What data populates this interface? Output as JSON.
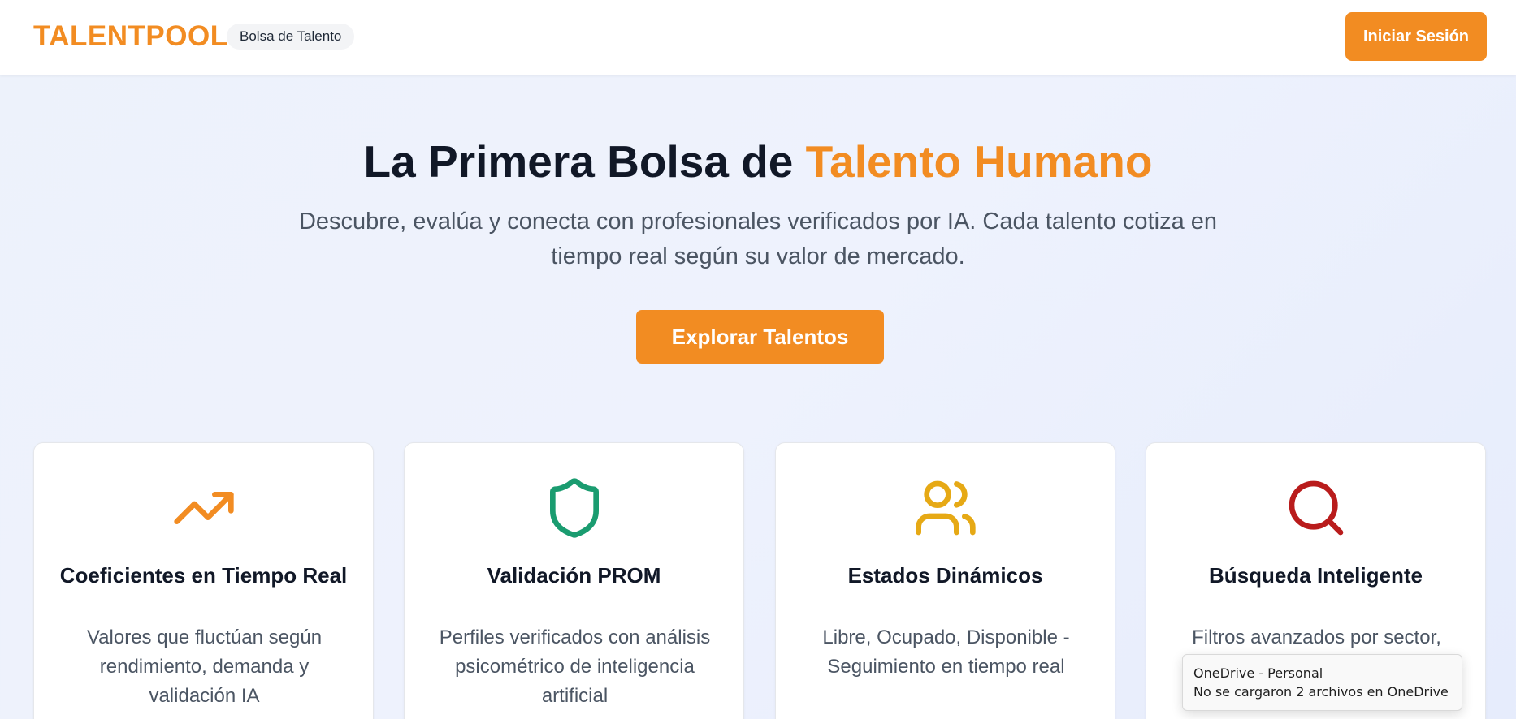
{
  "header": {
    "brand": "TALENTPOOL",
    "badge": "Bolsa de Talento",
    "login_label": "Iniciar Sesión"
  },
  "hero": {
    "title_main": "La Primera Bolsa de ",
    "title_accent": "Talento Humano",
    "subtitle": "Descubre, evalúa y conecta con profesionales verificados por IA. Cada talento cotiza en tiempo real según su valor de mercado.",
    "cta_label": "Explorar Talentos"
  },
  "features": [
    {
      "icon": "trending-up-icon",
      "color": "#f28c22",
      "title": "Coeficientes en Tiempo Real",
      "desc": "Valores que fluctúan según rendimiento, demanda y validación IA"
    },
    {
      "icon": "shield-icon",
      "color": "#1a9c70",
      "title": "Validación PROM",
      "desc": "Perfiles verificados con análisis psicométrico de inteligencia artificial"
    },
    {
      "icon": "users-icon",
      "color": "#e6a915",
      "title": "Estados Dinámicos",
      "desc": "Libre, Ocupado, Disponible - Seguimiento en tiempo real"
    },
    {
      "icon": "search-icon",
      "color": "#b91c1c",
      "title": "Búsqueda Inteligente",
      "desc": "Filtros avanzados por sector,"
    }
  ],
  "notification": {
    "title": "OneDrive - Personal",
    "message": "No se cargaron 2 archivos en OneDrive"
  },
  "colors": {
    "accent": "#f28c22"
  }
}
